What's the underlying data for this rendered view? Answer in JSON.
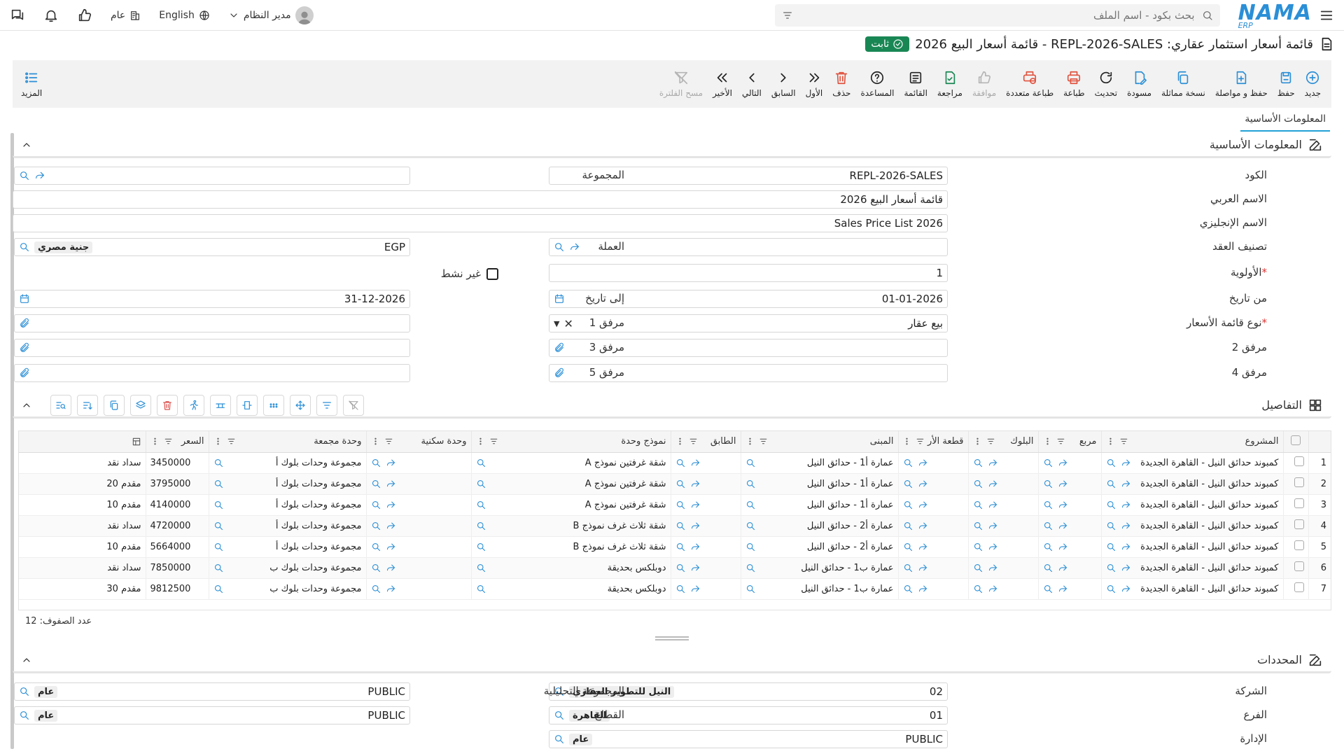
{
  "topbar": {
    "search_placeholder": "بحث بكود - اسم الملف",
    "logo_main": "NAMA",
    "logo_sub": "ERP",
    "user_name": "مدير النظام",
    "language": "English",
    "scope": "عام"
  },
  "page": {
    "title": "قائمة أسعار استثمار عقاري: REPL-2026-SALES - قائمة أسعار البيع 2026",
    "status": "ثابت"
  },
  "toolbar": [
    {
      "key": "new",
      "label": "جديد",
      "icon": "plus-circle",
      "enabled": true
    },
    {
      "key": "save",
      "label": "حفظ",
      "icon": "save",
      "enabled": true
    },
    {
      "key": "save-continue",
      "label": "حفظ و مواصلة",
      "icon": "file-plus",
      "enabled": true
    },
    {
      "key": "copy",
      "label": "نسخة مماثلة",
      "icon": "copy",
      "enabled": true
    },
    {
      "key": "draft",
      "label": "مسودة",
      "icon": "edit",
      "enabled": true
    },
    {
      "key": "refresh",
      "label": "تحديث",
      "icon": "refresh",
      "enabled": true
    },
    {
      "key": "print",
      "label": "طباعة",
      "icon": "printer",
      "enabled": true
    },
    {
      "key": "multi-print",
      "label": "طباعة متعددة",
      "icon": "printer-multi",
      "enabled": true
    },
    {
      "key": "approve",
      "label": "موافقة",
      "icon": "thumbs-up",
      "enabled": false
    },
    {
      "key": "review",
      "label": "مراجعة",
      "icon": "file-check",
      "enabled": true
    },
    {
      "key": "list",
      "label": "القائمة",
      "icon": "list",
      "enabled": true
    },
    {
      "key": "help",
      "label": "المساعدة",
      "icon": "help",
      "enabled": true
    },
    {
      "key": "delete",
      "label": "حذف",
      "icon": "trash",
      "enabled": true
    },
    {
      "key": "first",
      "label": "الأول",
      "icon": "chevrons-right",
      "enabled": true
    },
    {
      "key": "prev",
      "label": "السابق",
      "icon": "chevron-right",
      "enabled": true
    },
    {
      "key": "next",
      "label": "التالي",
      "icon": "chevron-left",
      "enabled": true
    },
    {
      "key": "last",
      "label": "الأخير",
      "icon": "chevrons-left",
      "enabled": true
    },
    {
      "key": "clear-filter",
      "label": "مسح الفلترة",
      "icon": "filter-x",
      "enabled": false
    }
  ],
  "more_label": "المزيد",
  "tabs": [
    "المعلومات الأساسية"
  ],
  "sections": {
    "basic": "المعلومات الأساسية",
    "details": "التفاصيل",
    "dimensions": "المحددات"
  },
  "form": {
    "code_label": "الكود",
    "code": "REPL-2026-SALES",
    "group_label": "المجموعة",
    "group": "",
    "ar_name_label": "الاسم العربي",
    "ar_name": "قائمة أسعار البيع 2026",
    "en_name_label": "الاسم الإنجليزي",
    "en_name": "Sales Price List 2026",
    "contract_label": "تصنيف العقد",
    "contract": "",
    "currency_label": "العملة",
    "currency_code": "EGP",
    "currency_name": "جنية مصري",
    "priority_label": "الأولوية",
    "priority": "1",
    "inactive_label": "غير نشط",
    "from_label": "من تاريخ",
    "from_date": "01-01-2026",
    "to_label": "إلى تاريخ",
    "to_date": "31-12-2026",
    "type_label": "نوع قائمة الأسعار",
    "type": "بيع عقار",
    "att1_label": "مرفق 1",
    "att2_label": "مرفق 2",
    "att3_label": "مرفق 3",
    "att4_label": "مرفق 4",
    "att5_label": "مرفق 5"
  },
  "grid": {
    "columns": [
      "المشروع",
      "مربع",
      "البلوك",
      "قطعة الأر",
      "المبنى",
      "الطابق",
      "نموذج وحدة",
      "وحدة سكنية",
      "وحدة مجمعة",
      "السعر"
    ],
    "rows": [
      {
        "n": "1",
        "project": "كمبوند حدائق النيل - القاهرة الجديدة",
        "building": "عمارة أ1 - حدائق النيل",
        "model": "شقة غرفتين نموذج A",
        "group": "مجموعة وحدات بلوك أ",
        "price": "3450000",
        "extra": "سداد نقد"
      },
      {
        "n": "2",
        "project": "كمبوند حدائق النيل - القاهرة الجديدة",
        "building": "عمارة أ1 - حدائق النيل",
        "model": "شقة غرفتين نموذج A",
        "group": "مجموعة وحدات بلوك أ",
        "price": "3795000",
        "extra": "مقدم 20"
      },
      {
        "n": "3",
        "project": "كمبوند حدائق النيل - القاهرة الجديدة",
        "building": "عمارة أ1 - حدائق النيل",
        "model": "شقة غرفتين نموذج A",
        "group": "مجموعة وحدات بلوك أ",
        "price": "4140000",
        "extra": "مقدم 10"
      },
      {
        "n": "4",
        "project": "كمبوند حدائق النيل - القاهرة الجديدة",
        "building": "عمارة أ2 - حدائق النيل",
        "model": "شقة ثلاث غرف نموذج B",
        "group": "مجموعة وحدات بلوك أ",
        "price": "4720000",
        "extra": "سداد نقد"
      },
      {
        "n": "5",
        "project": "كمبوند حدائق النيل - القاهرة الجديدة",
        "building": "عمارة أ2 - حدائق النيل",
        "model": "شقة ثلاث غرف نموذج B",
        "group": "مجموعة وحدات بلوك أ",
        "price": "5664000",
        "extra": "مقدم 10"
      },
      {
        "n": "6",
        "project": "كمبوند حدائق النيل - القاهرة الجديدة",
        "building": "عمارة ب1 - حدائق النيل",
        "model": "دوبلكس بحديقة",
        "group": "مجموعة وحدات بلوك ب",
        "price": "7850000",
        "extra": "سداد نقد"
      },
      {
        "n": "7",
        "project": "كمبوند حدائق النيل - القاهرة الجديدة",
        "building": "عمارة ب1 - حدائق النيل",
        "model": "دوبلكس بحديقة",
        "group": "مجموعة وحدات بلوك ب",
        "price": "9812500",
        "extra": "مقدم 30"
      }
    ],
    "row_count": "عدد الصفوف: 12"
  },
  "dimensions": {
    "company_label": "الشركة",
    "company_code": "02",
    "company_name": "النيل للتطوير العقاري",
    "branch_label": "الفرع",
    "branch_code": "01",
    "branch_name": "القاهرة",
    "dept_label": "الإدارة",
    "dept_code": "PUBLIC",
    "dept_name": "عام",
    "analytic_label": "المجموعة التحليلية",
    "analytic_code": "PUBLIC",
    "analytic_name": "عام",
    "sector_label": "القطاع",
    "sector_code": "PUBLIC",
    "sector_name": "عام"
  },
  "colors": {
    "accent": "#2b8fd6",
    "status": "#198754",
    "danger": "#d9534f"
  }
}
